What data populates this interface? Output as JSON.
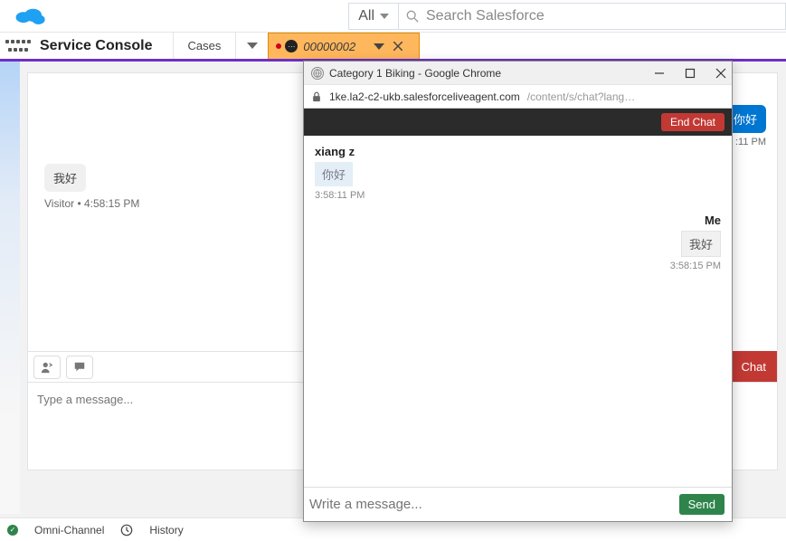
{
  "salesforce": {
    "scope": "All",
    "search_placeholder": "Search Salesforce",
    "app_title": "Service Console",
    "tabs": {
      "cases": "Cases",
      "record": "00000002"
    }
  },
  "background_chat": {
    "left_msg": "我好",
    "left_meta": "Visitor • 4:58:15 PM",
    "right_msg": "你好",
    "right_time": ":11 PM",
    "type_placeholder": "Type a message...",
    "chat_button": "Chat"
  },
  "footer": {
    "omni": "Omni-Channel",
    "history": "History"
  },
  "chrome": {
    "title": "Category 1 Biking - Google Chrome",
    "url_secure": "1ke.la2-c2-ukb.salesforceliveagent.com",
    "url_path": "/content/s/chat?lang…"
  },
  "chat": {
    "end": "End Chat",
    "user_name": "xiang z",
    "user_msg": "你好",
    "user_time": "3:58:11 PM",
    "me_name": "Me",
    "me_msg": "我好",
    "me_time": "3:58:15 PM",
    "input_placeholder": "Write a message...",
    "send": "Send"
  }
}
